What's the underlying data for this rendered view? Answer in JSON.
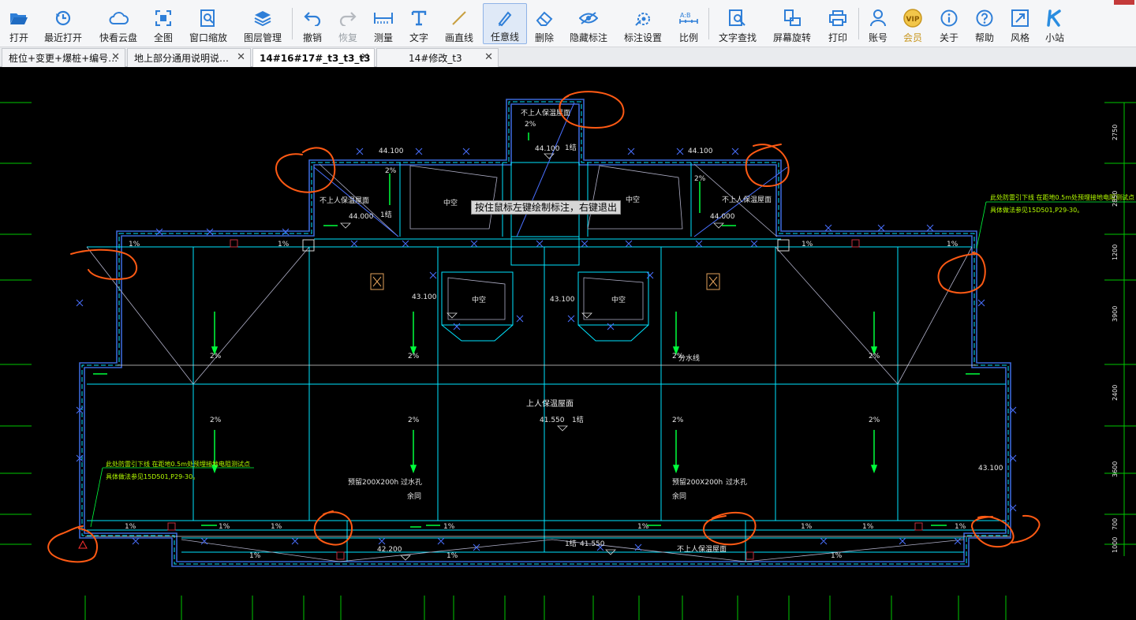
{
  "toolbar": {
    "items": [
      {
        "label": "打开"
      },
      {
        "label": "最近打开"
      },
      {
        "label": "快看云盘"
      },
      {
        "label": "全图"
      },
      {
        "label": "窗口缩放"
      },
      {
        "label": "图层管理"
      },
      {
        "label": "撤销"
      },
      {
        "label": "恢复"
      },
      {
        "label": "测量"
      },
      {
        "label": "文字"
      },
      {
        "label": "画直线"
      },
      {
        "label": "任意线"
      },
      {
        "label": "删除"
      },
      {
        "label": "隐藏标注"
      },
      {
        "label": "标注设置"
      },
      {
        "label": "比例"
      },
      {
        "label": "文字查找"
      },
      {
        "label": "屏幕旋转"
      },
      {
        "label": "打印"
      },
      {
        "label": "账号"
      },
      {
        "label": "会员"
      },
      {
        "label": "关于"
      },
      {
        "label": "帮助"
      },
      {
        "label": "风格"
      },
      {
        "label": "小站"
      }
    ],
    "vip_badge": "VIP"
  },
  "tabs": [
    {
      "label": "桩位+变更+爆桩+编号…",
      "close": "✕"
    },
    {
      "label": "地上部分通用说明说…",
      "close": "✕"
    },
    {
      "label": "14#16#17#_t3_t3_t3",
      "close": "✕"
    },
    {
      "label": "14#修改_t3",
      "close": "✕"
    }
  ],
  "canvas": {
    "tooltip": "按住鼠标左键绘制标注，右键退出",
    "texts": {
      "roof_no_access_1": "不上人保温屋面",
      "roof_no_access_2": "不上人保温屋面",
      "roof_no_access_3": "不上人保温屋面",
      "roof_no_access_4": "不上人保温屋面",
      "roof_access": "上人保温屋面",
      "void_1": "中空",
      "void_2": "中空",
      "void_3": "中空",
      "void_4": "中空",
      "elev_44100_a": "44.100",
      "elev_44100_b": "44.100",
      "elev_44100_c": "44.100",
      "elev_44000_a": "44.000",
      "elev_44000_b": "44.000",
      "elev_43100_a": "43.100",
      "elev_43100_b": "43.100",
      "elev_43100_c": "43.100",
      "elev_41550": "41.550",
      "elev_41550_b": "41.550",
      "elev_42200": "42.200",
      "slope": "2%",
      "slope1": "1%",
      "slope_label_top": "2%",
      "gutter": "分水线",
      "drain_note_1": "预留200X200h",
      "drain_note_2": "过水孔",
      "drain_note_3": "余同",
      "drain_note_b1": "预留200X200h",
      "drain_note_b2": "过水孔",
      "drain_note_b3": "余同",
      "lightning_left_1": "此处防雷引下线 在距地0.5m处预埋接地电阻测试点",
      "lightning_left_2": "具体做法参见15D501,P29-30。",
      "lightning_right_1": "此处防雷引下线 在距地0.5m处预埋接地电阻测试点",
      "lightning_right_2": "具体做法参见15D501,P29-30。",
      "tag_1": "1结",
      "tag_2": "1结",
      "tag_3": "1结",
      "tag_4": "1结",
      "dims": [
        "2750",
        "2850",
        "1200",
        "3900",
        "2400",
        "3600",
        "700",
        "1000"
      ]
    }
  },
  "colors": {
    "cyan": "#00e5ff",
    "wall_blue": "#3b68d8",
    "green": "#00ff3c",
    "white_line": "#d8d8d8",
    "annotation_orange": "#ff5a14",
    "text_white": "#e6e6e6",
    "yellow_green": "#b6ff00"
  }
}
